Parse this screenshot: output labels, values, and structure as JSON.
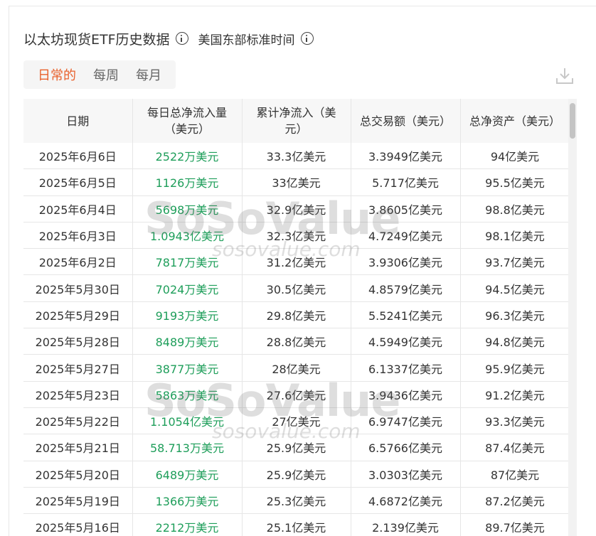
{
  "header": {
    "title": "以太坊现货ETF历史数据",
    "timezone": "美国东部标准时间"
  },
  "tabs": [
    {
      "label": "日常的",
      "active": true
    },
    {
      "label": "每周",
      "active": false
    },
    {
      "label": "每月",
      "active": false
    }
  ],
  "table": {
    "columns": [
      "日期",
      "每日总净流入量（美元）",
      "累计净流入（美元）",
      "总交易额（美元）",
      "总净资产（美元）"
    ],
    "rows": [
      [
        "2025年6月6日",
        "2522万美元",
        "33.3亿美元",
        "3.3949亿美元",
        "94亿美元"
      ],
      [
        "2025年6月5日",
        "1126万美元",
        "33亿美元",
        "5.717亿美元",
        "95.5亿美元"
      ],
      [
        "2025年6月4日",
        "5698万美元",
        "32.9亿美元",
        "3.8605亿美元",
        "98.8亿美元"
      ],
      [
        "2025年6月3日",
        "1.0943亿美元",
        "32.3亿美元",
        "4.7249亿美元",
        "98.1亿美元"
      ],
      [
        "2025年6月2日",
        "7817万美元",
        "31.2亿美元",
        "3.9306亿美元",
        "93.7亿美元"
      ],
      [
        "2025年5月30日",
        "7024万美元",
        "30.5亿美元",
        "4.8579亿美元",
        "94.5亿美元"
      ],
      [
        "2025年5月29日",
        "9193万美元",
        "29.8亿美元",
        "5.5241亿美元",
        "96.3亿美元"
      ],
      [
        "2025年5月28日",
        "8489万美元",
        "28.8亿美元",
        "4.5949亿美元",
        "94.8亿美元"
      ],
      [
        "2025年5月27日",
        "3877万美元",
        "28亿美元",
        "6.1337亿美元",
        "95.9亿美元"
      ],
      [
        "2025年5月23日",
        "5863万美元",
        "27.6亿美元",
        "3.9436亿美元",
        "91.2亿美元"
      ],
      [
        "2025年5月22日",
        "1.1054亿美元",
        "27亿美元",
        "6.9747亿美元",
        "93.3亿美元"
      ],
      [
        "2025年5月21日",
        "58.713万美元",
        "25.9亿美元",
        "6.5766亿美元",
        "87.4亿美元"
      ],
      [
        "2025年5月20日",
        "6489万美元",
        "25.9亿美元",
        "3.0303亿美元",
        "87亿美元"
      ],
      [
        "2025年5月19日",
        "1366万美元",
        "25.3亿美元",
        "4.6872亿美元",
        "87.2亿美元"
      ],
      [
        "2025年5月16日",
        "2212万美元",
        "25.1亿美元",
        "2.139亿美元",
        "89.7亿美元"
      ]
    ]
  },
  "watermark": {
    "brand": "SoSoValue",
    "site": "sosovalue.com"
  },
  "colors": {
    "accent": "#e8612c",
    "positive": "#1e9e5a"
  },
  "icons": {
    "info": "info-icon",
    "download": "download-icon"
  }
}
